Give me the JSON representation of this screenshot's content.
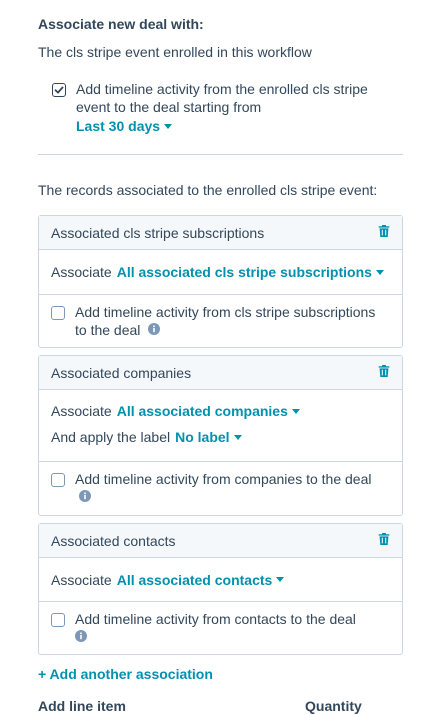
{
  "section": {
    "heading": "Associate new deal with:",
    "enrolled_text": "The cls stripe event enrolled in this workflow",
    "timeline_check": {
      "checked": true,
      "label": "Add timeline activity from the enrolled cls stripe event to the deal starting from",
      "range_value": "Last 30 days"
    },
    "records_text": "The records associated to the enrolled cls stripe event:"
  },
  "cards": [
    {
      "title": "Associated cls stripe subscriptions",
      "associate_label": "Associate",
      "associate_value": "All associated cls stripe subscriptions",
      "checkbox_label": "Add timeline activity from cls stripe subscriptions to the deal",
      "checked": false
    },
    {
      "title": "Associated companies",
      "associate_label": "Associate",
      "associate_value": "All associated companies",
      "apply_label_text": "And apply the label",
      "apply_label_value": "No label",
      "checkbox_label": "Add timeline activity from companies to the deal",
      "checked": false
    },
    {
      "title": "Associated contacts",
      "associate_label": "Associate",
      "associate_value": "All associated contacts",
      "checkbox_label": "Add timeline activity from contacts to the deal",
      "checked": false
    }
  ],
  "add_association": "+ Add another association",
  "line_item_header": "Add line item",
  "quantity_header": "Quantity",
  "colors": {
    "link": "#0091ae",
    "text": "#33475b",
    "border": "#cbd6e2",
    "header_bg": "#f5f8fa"
  },
  "icons": {
    "delete": "trash-icon",
    "info": "info-icon",
    "check": "checkmark-icon"
  }
}
